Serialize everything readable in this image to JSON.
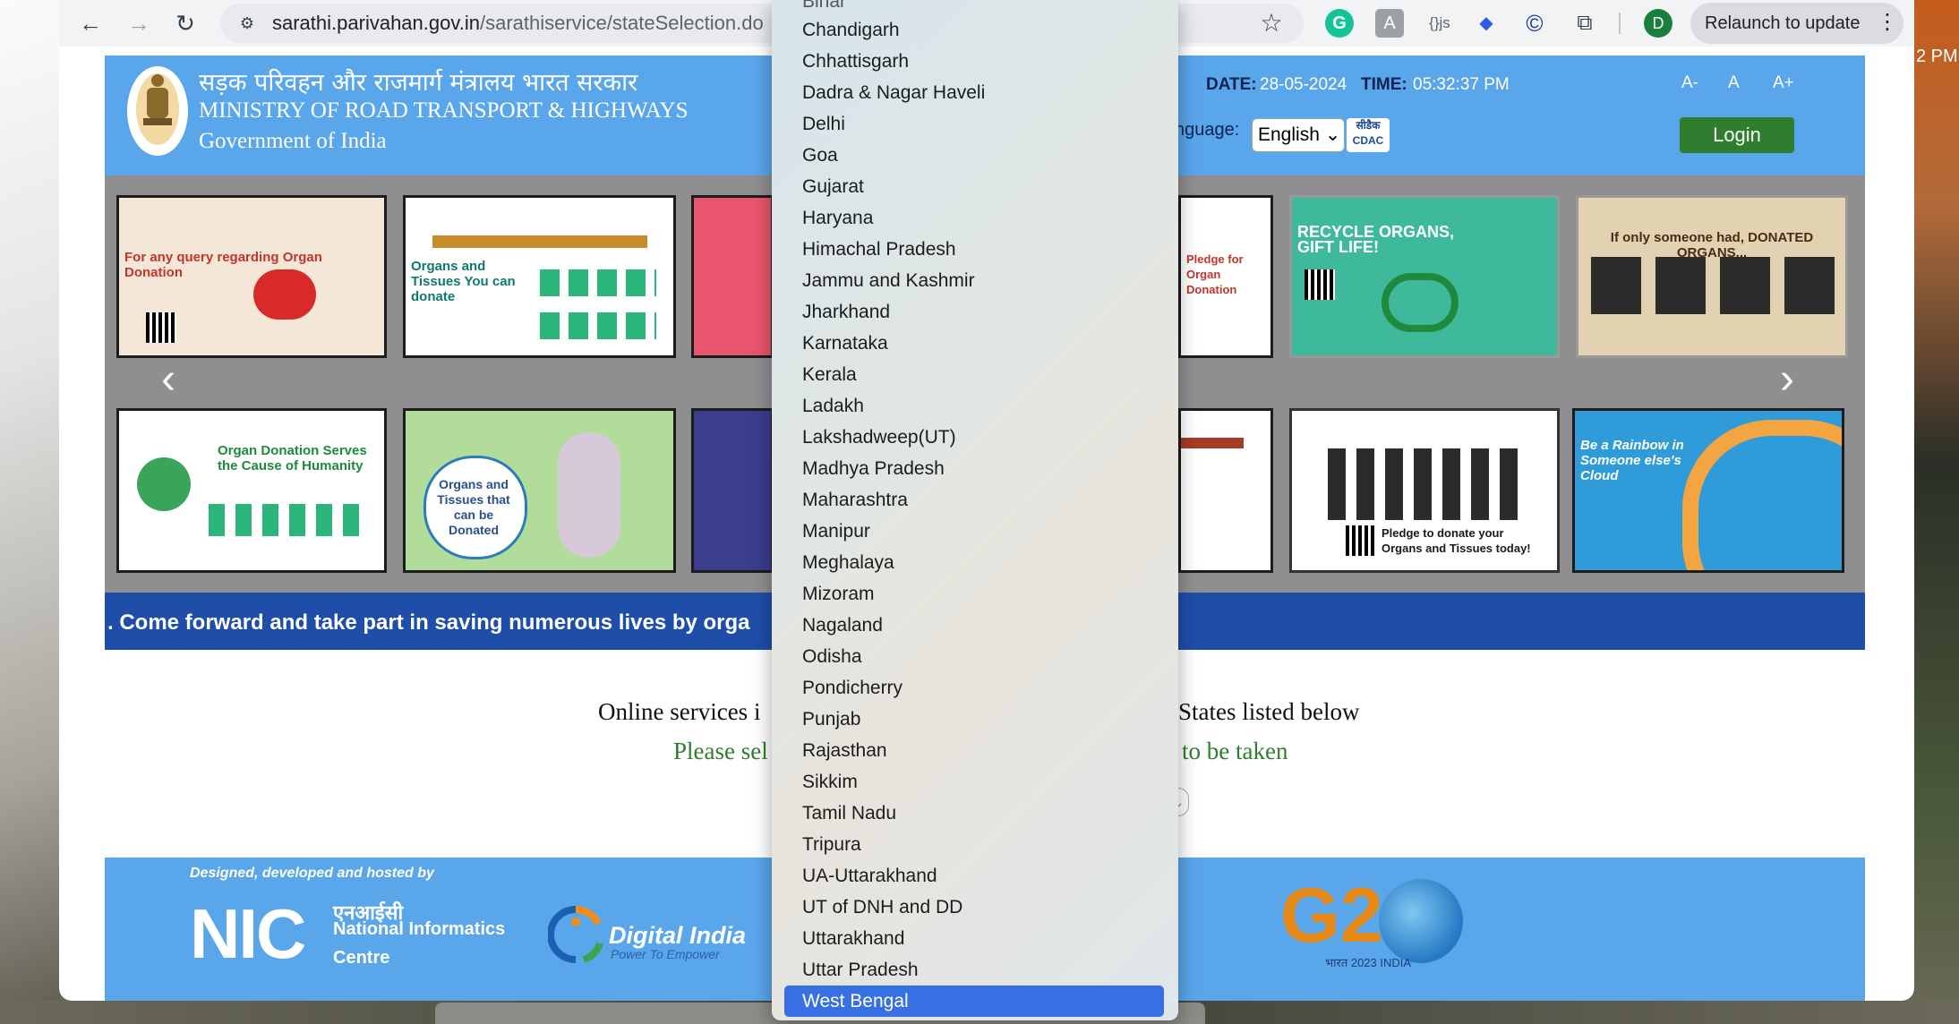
{
  "browser": {
    "url_host": "sarathi.parivahan.gov.in",
    "url_path": "/sarathiservice/stateSelection.do",
    "profile_initial": "D",
    "relaunch_label": "Relaunch to update",
    "back_glyph": "←",
    "forward_glyph": "→",
    "reload_glyph": "↻",
    "star_glyph": "☆",
    "menu_glyph": "⋮",
    "icons": [
      "back-icon",
      "forward-icon",
      "reload-icon",
      "site-info-icon",
      "bookmark-star-icon",
      "grammarly-icon",
      "translate-icon",
      "javascript-icon",
      "graduation-cap-icon",
      "copyright-icon",
      "extensions-puzzle-icon"
    ]
  },
  "desktop": {
    "clock_fragment": "2 PM"
  },
  "header": {
    "ministry_hindi": "सड़क परिवहन और राजमार्ग मंत्रालय भारत सरकार",
    "ministry_english": "MINISTRY OF ROAD TRANSPORT & HIGHWAYS",
    "government": "Government of India",
    "date_label": "DATE:",
    "date_value": "28-05-2024",
    "time_label": "TIME:",
    "time_value": "05:32:37 PM",
    "font_smaller": "A-",
    "font_normal": "A",
    "font_larger": "A+",
    "language_label": "nguage:",
    "language_value": "English ⌄",
    "cdac_top": "सीडैक",
    "cdac_bottom": "CDAC",
    "login_label": "Login"
  },
  "carousel": {
    "prev_glyph": "‹",
    "next_glyph": "›",
    "posters": [
      {
        "title": "For any query regarding Organ Donation"
      },
      {
        "title": "Organs and Tissues You can donate"
      },
      {
        "title": "Pledge for Organ Donation"
      },
      {
        "title": "RECYCLE ORGANS, GIFT LIFE!"
      },
      {
        "title": "If only someone had, DONATED ORGANS..."
      },
      {
        "title": "Organ Donation Serves the Cause of Humanity"
      },
      {
        "title": "Organs and Tissues that can be Donated"
      },
      {
        "title": "Pledge to donate your Organs and Tissues today!"
      },
      {
        "title": "Be a Rainbow in Someone else's Cloud"
      }
    ]
  },
  "ticker_text": ". Come forward and take part in saving numerous lives by orga",
  "main": {
    "online_text_left": "Online services i",
    "online_text_right": "States listed below",
    "please_left": "Please sel",
    "please_right": "to be taken"
  },
  "footer": {
    "designed_by": "Designed, developed and hosted by",
    "nic_logo": "NIC",
    "nic_hindi": "एनआईसी",
    "nic_line1": "National Informatics",
    "nic_line2": "Centre",
    "digital_india": "Digital India",
    "digital_india_tag": "Power To Empower",
    "g20_text": "G2",
    "g20_sub": "भारत 2023 INDIA"
  },
  "state_dropdown": {
    "partial_top": "Bihar",
    "options": [
      "Chandigarh",
      "Chhattisgarh",
      "Dadra & Nagar Haveli",
      "Delhi",
      "Goa",
      "Gujarat",
      "Haryana",
      "Himachal Pradesh",
      "Jammu and Kashmir",
      "Jharkhand",
      "Karnataka",
      "Kerala",
      "Ladakh",
      "Lakshadweep(UT)",
      "Madhya Pradesh",
      "Maharashtra",
      "Manipur",
      "Meghalaya",
      "Mizoram",
      "Nagaland",
      "Odisha",
      "Pondicherry",
      "Punjab",
      "Rajasthan",
      "Sikkim",
      "Tamil Nadu",
      "Tripura",
      "UA-Uttarakhand",
      "UT of DNH and DD",
      "Uttarakhand",
      "Uttar Pradesh",
      "West Bengal"
    ],
    "selected": "West Bengal"
  },
  "colors": {
    "header_blue": "#5aa6ea",
    "ticker_blue": "#1f4ea8",
    "login_green": "#2f7d2f",
    "selection_blue": "#3670e3"
  }
}
